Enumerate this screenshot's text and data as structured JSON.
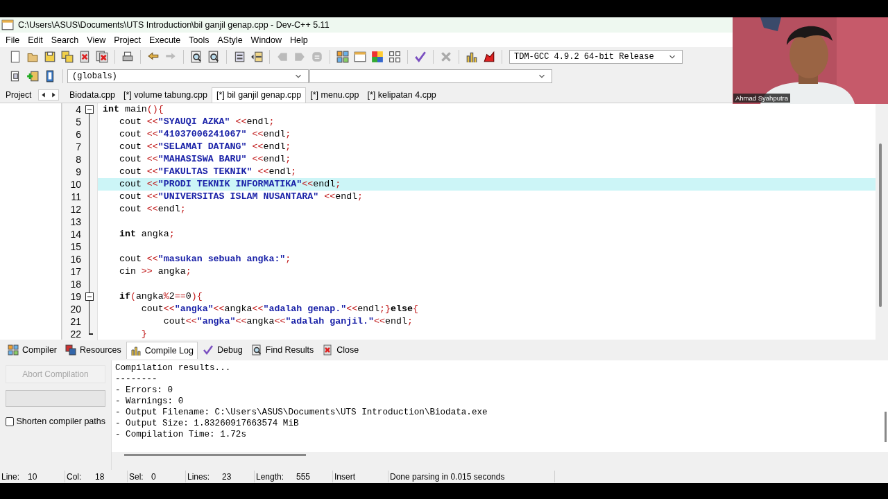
{
  "window": {
    "title": "C:\\Users\\ASUS\\Documents\\UTS Introduction\\bil ganjil genap.cpp - Dev-C++ 5.11"
  },
  "menu": [
    "File",
    "Edit",
    "Search",
    "View",
    "Project",
    "Execute",
    "Tools",
    "AStyle",
    "Window",
    "Help"
  ],
  "toolbar": {
    "compiler": "TDM-GCC 4.9.2 64-bit Release",
    "scope": "(globals)"
  },
  "side_panel": {
    "tab": "Project"
  },
  "file_tabs": [
    {
      "label": "Biodata.cpp",
      "selected": false
    },
    {
      "label": "[*] volume tabung.cpp",
      "selected": false
    },
    {
      "label": "[*] bil ganjil genap.cpp",
      "selected": true
    },
    {
      "label": "[*] menu.cpp",
      "selected": false
    },
    {
      "label": "[*] kelipatan 4.cpp",
      "selected": false
    }
  ],
  "code_lines": [
    {
      "number": "4",
      "fold_start": true,
      "selected": false,
      "tokens": [
        {
          "kind": "keyword",
          "text": "int"
        },
        {
          "kind": "plain",
          "text": " main"
        },
        {
          "kind": "op",
          "text": "(){"
        }
      ]
    },
    {
      "number": "5",
      "selected": false,
      "tokens": [
        {
          "kind": "plain",
          "text": "   cout "
        },
        {
          "kind": "op",
          "text": "<<"
        },
        {
          "kind": "string",
          "text": "\"SYAUQI AZKA\""
        },
        {
          "kind": "op",
          "text": " <<"
        },
        {
          "kind": "plain",
          "text": "endl"
        },
        {
          "kind": "op",
          "text": ";"
        }
      ]
    },
    {
      "number": "6",
      "selected": false,
      "tokens": [
        {
          "kind": "plain",
          "text": "   cout "
        },
        {
          "kind": "op",
          "text": "<<"
        },
        {
          "kind": "string",
          "text": "\"41037006241067\""
        },
        {
          "kind": "op",
          "text": " <<"
        },
        {
          "kind": "plain",
          "text": "endl"
        },
        {
          "kind": "op",
          "text": ";"
        }
      ]
    },
    {
      "number": "7",
      "selected": false,
      "tokens": [
        {
          "kind": "plain",
          "text": "   cout "
        },
        {
          "kind": "op",
          "text": "<<"
        },
        {
          "kind": "string",
          "text": "\"SELAMAT DATANG\""
        },
        {
          "kind": "op",
          "text": " <<"
        },
        {
          "kind": "plain",
          "text": "endl"
        },
        {
          "kind": "op",
          "text": ";"
        }
      ]
    },
    {
      "number": "8",
      "selected": false,
      "tokens": [
        {
          "kind": "plain",
          "text": "   cout "
        },
        {
          "kind": "op",
          "text": "<<"
        },
        {
          "kind": "string",
          "text": "\"MAHASISWA BARU\""
        },
        {
          "kind": "op",
          "text": " <<"
        },
        {
          "kind": "plain",
          "text": "endl"
        },
        {
          "kind": "op",
          "text": ";"
        }
      ]
    },
    {
      "number": "9",
      "selected": false,
      "tokens": [
        {
          "kind": "plain",
          "text": "   cout "
        },
        {
          "kind": "op",
          "text": "<<"
        },
        {
          "kind": "string",
          "text": "\"FAKULTAS TEKNIK\""
        },
        {
          "kind": "op",
          "text": " <<"
        },
        {
          "kind": "plain",
          "text": "endl"
        },
        {
          "kind": "op",
          "text": ";"
        }
      ]
    },
    {
      "number": "10",
      "selected": true,
      "tokens": [
        {
          "kind": "plain",
          "text": "   cout "
        },
        {
          "kind": "op",
          "text": "<<"
        },
        {
          "kind": "string",
          "text": "\"PRODI TEKNIK INFORMATIKA\""
        },
        {
          "kind": "op",
          "text": "<<"
        },
        {
          "kind": "plain",
          "text": "endl"
        },
        {
          "kind": "op",
          "text": ";"
        }
      ]
    },
    {
      "number": "11",
      "selected": false,
      "tokens": [
        {
          "kind": "plain",
          "text": "   cout "
        },
        {
          "kind": "op",
          "text": "<<"
        },
        {
          "kind": "string",
          "text": "\"UNIVERSITAS ISLAM NUSANTARA\""
        },
        {
          "kind": "op",
          "text": " <<"
        },
        {
          "kind": "plain",
          "text": "endl"
        },
        {
          "kind": "op",
          "text": ";"
        }
      ]
    },
    {
      "number": "12",
      "selected": false,
      "tokens": [
        {
          "kind": "plain",
          "text": "   cout "
        },
        {
          "kind": "op",
          "text": "<<"
        },
        {
          "kind": "plain",
          "text": "endl"
        },
        {
          "kind": "op",
          "text": ";"
        }
      ]
    },
    {
      "number": "13",
      "selected": false
    },
    {
      "number": "14",
      "selected": false,
      "tokens": [
        {
          "kind": "keyword",
          "text": "   int"
        },
        {
          "kind": "plain",
          "text": " angka"
        },
        {
          "kind": "op",
          "text": ";"
        }
      ]
    },
    {
      "number": "15",
      "selected": false
    },
    {
      "number": "16",
      "selected": false,
      "tokens": [
        {
          "kind": "plain",
          "text": "   cout "
        },
        {
          "kind": "op",
          "text": "<<"
        },
        {
          "kind": "string",
          "text": "\"masukan sebuah angka:\""
        },
        {
          "kind": "op",
          "text": ";"
        }
      ]
    },
    {
      "number": "17",
      "selected": false,
      "tokens": [
        {
          "kind": "plain",
          "text": "   cin "
        },
        {
          "kind": "op",
          "text": ">>"
        },
        {
          "kind": "plain",
          "text": " angka"
        },
        {
          "kind": "op",
          "text": ";"
        }
      ]
    },
    {
      "number": "18",
      "selected": false
    },
    {
      "number": "19",
      "fold_start": true,
      "selected": false,
      "tokens": [
        {
          "kind": "keyword",
          "text": "   if"
        },
        {
          "kind": "op",
          "text": "("
        },
        {
          "kind": "plain",
          "text": "angka"
        },
        {
          "kind": "op",
          "text": "%"
        },
        {
          "kind": "plain",
          "text": "2"
        },
        {
          "kind": "op",
          "text": "=="
        },
        {
          "kind": "plain",
          "text": "0"
        },
        {
          "kind": "op",
          "text": "){"
        }
      ]
    },
    {
      "number": "20",
      "selected": false,
      "tokens": [
        {
          "kind": "plain",
          "text": "       cout"
        },
        {
          "kind": "op",
          "text": "<<"
        },
        {
          "kind": "string",
          "text": "\"angka\""
        },
        {
          "kind": "op",
          "text": "<<"
        },
        {
          "kind": "plain",
          "text": "angka"
        },
        {
          "kind": "op",
          "text": "<<"
        },
        {
          "kind": "string",
          "text": "\"adalah genap.\""
        },
        {
          "kind": "op",
          "text": "<<"
        },
        {
          "kind": "plain",
          "text": "endl"
        },
        {
          "kind": "op",
          "text": ";}"
        },
        {
          "kind": "keyword",
          "text": "else"
        },
        {
          "kind": "op",
          "text": "{"
        }
      ]
    },
    {
      "number": "21",
      "selected": false,
      "tokens": [
        {
          "kind": "plain",
          "text": "           cout"
        },
        {
          "kind": "op",
          "text": "<<"
        },
        {
          "kind": "string",
          "text": "\"angka\""
        },
        {
          "kind": "op",
          "text": "<<"
        },
        {
          "kind": "plain",
          "text": "angka"
        },
        {
          "kind": "op",
          "text": "<<"
        },
        {
          "kind": "string",
          "text": "\"adalah ganjil.\""
        },
        {
          "kind": "op",
          "text": "<<"
        },
        {
          "kind": "plain",
          "text": "endl"
        },
        {
          "kind": "op",
          "text": ";"
        }
      ]
    },
    {
      "number": "22",
      "fold_end": true,
      "selected": false,
      "tokens": [
        {
          "kind": "op",
          "text": "       }"
        }
      ]
    }
  ],
  "bottom_tabs": [
    {
      "label": "Compiler",
      "selected": false
    },
    {
      "label": "Resources",
      "selected": false
    },
    {
      "label": "Compile Log",
      "selected": true
    },
    {
      "label": "Debug",
      "selected": false
    },
    {
      "label": "Find Results",
      "selected": false
    },
    {
      "label": "Close",
      "selected": false
    }
  ],
  "compile_panel": {
    "abort_button": {
      "label": "Abort Compilation",
      "disabled": true
    },
    "shorten_paths": {
      "label": "Shorten compiler paths",
      "checked": false
    },
    "log": [
      "Compilation results...",
      "--------",
      "- Errors: 0",
      "- Warnings: 0",
      "- Output Filename: C:\\Users\\ASUS\\Documents\\UTS Introduction\\Biodata.exe",
      "- Output Size: 1.83260917663574 MiB",
      "- Compilation Time: 1.72s"
    ]
  },
  "status_bar": [
    {
      "label": "Line:",
      "value": "10"
    },
    {
      "label": "Col:",
      "value": "18"
    },
    {
      "label": "Sel:",
      "value": "0"
    },
    {
      "label": "Lines:",
      "value": "23"
    },
    {
      "label": "Length:",
      "value": "555"
    },
    {
      "value": "Insert"
    },
    {
      "value": "Done parsing in 0.015 seconds"
    }
  ],
  "webcam": {
    "kind": "picture",
    "name": "Ahmad Syahputra"
  }
}
